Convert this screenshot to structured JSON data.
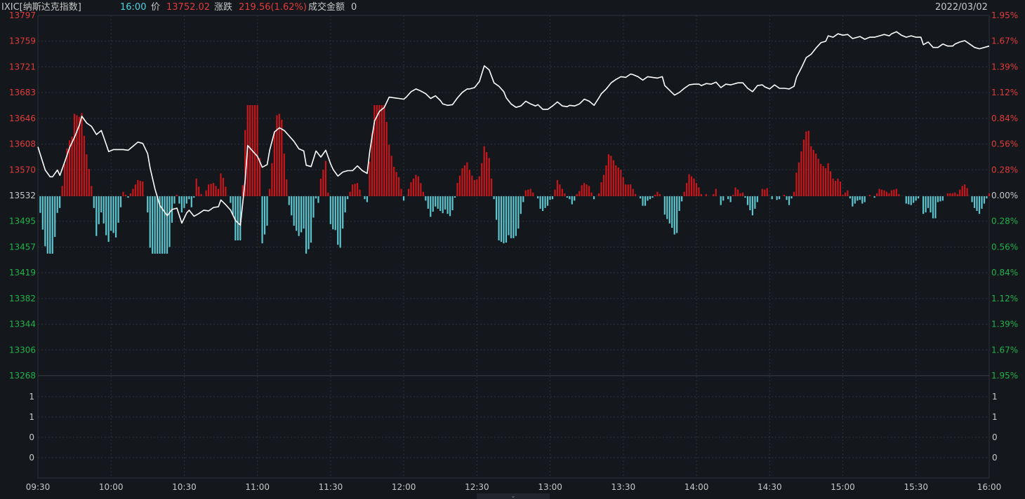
{
  "header": {
    "symbol": "IXIC[纳斯达克指数]",
    "time": "16:00",
    "price_label": "价",
    "price": "13752.02",
    "change_label": "涨跌",
    "change": "219.56(1.62%)",
    "amount_label": "成交金额",
    "amount": "0",
    "date": "2022/03/02"
  },
  "colors": {
    "background": "#14171c",
    "up": "#e03c3c",
    "down": "#22b14c",
    "bar_up": "#c8161a",
    "bar_down": "#5cc6d0",
    "price_line": "#ffffff",
    "time_cyan": "#4fd1e0",
    "text": "#c8c8c8",
    "grid": "#2e333a"
  },
  "chart_data": {
    "type": "line",
    "base_price": 13532,
    "price_axis_left": [
      "13797",
      "13759",
      "13721",
      "13683",
      "13646",
      "13608",
      "13570",
      "13532",
      "13495",
      "13457",
      "13419",
      "13382",
      "13344",
      "13306",
      "13268"
    ],
    "price_axis_right": [
      "1.95%",
      "1.67%",
      "1.39%",
      "1.12%",
      "0.84%",
      "0.56%",
      "0.28%",
      "0.00%",
      "0.28%",
      "0.56%",
      "0.84%",
      "1.12%",
      "1.39%",
      "1.67%",
      "1.95%"
    ],
    "ylim": [
      13268,
      13797
    ],
    "volume_axis": [
      "1",
      "1",
      "0",
      "0"
    ],
    "time_axis": [
      "09:30",
      "10:00",
      "10:30",
      "11:00",
      "11:30",
      "12:00",
      "12:30",
      "13:00",
      "13:30",
      "14:00",
      "14:30",
      "15:00",
      "15:30",
      "16:00"
    ],
    "total_minutes": 390,
    "price_series": [
      [
        0,
        13604
      ],
      [
        3,
        13570
      ],
      [
        5,
        13560
      ],
      [
        6,
        13560
      ],
      [
        8,
        13570
      ],
      [
        9,
        13562
      ],
      [
        11,
        13582
      ],
      [
        13,
        13603
      ],
      [
        15,
        13618
      ],
      [
        17,
        13636
      ],
      [
        18,
        13649
      ],
      [
        20,
        13639
      ],
      [
        22,
        13634
      ],
      [
        24,
        13622
      ],
      [
        26,
        13628
      ],
      [
        27,
        13618
      ],
      [
        29,
        13597
      ],
      [
        31,
        13600
      ],
      [
        33,
        13600
      ],
      [
        35,
        13600
      ],
      [
        37,
        13599
      ],
      [
        39,
        13605
      ],
      [
        41,
        13611
      ],
      [
        43,
        13609
      ],
      [
        45,
        13594
      ],
      [
        46,
        13573
      ],
      [
        48,
        13542
      ],
      [
        50,
        13518
      ],
      [
        52,
        13508
      ],
      [
        53,
        13503
      ],
      [
        55,
        13512
      ],
      [
        57,
        13514
      ],
      [
        59,
        13492
      ],
      [
        61,
        13507
      ],
      [
        62,
        13511
      ],
      [
        64,
        13502
      ],
      [
        66,
        13506
      ],
      [
        68,
        13511
      ],
      [
        70,
        13510
      ],
      [
        72,
        13515
      ],
      [
        74,
        13516
      ],
      [
        75,
        13526
      ],
      [
        77,
        13519
      ],
      [
        79,
        13511
      ],
      [
        81,
        13496
      ],
      [
        83,
        13489
      ],
      [
        85,
        13556
      ],
      [
        86,
        13606
      ],
      [
        88,
        13598
      ],
      [
        90,
        13590
      ],
      [
        92,
        13574
      ],
      [
        94,
        13578
      ],
      [
        95,
        13599
      ],
      [
        97,
        13626
      ],
      [
        99,
        13632
      ],
      [
        101,
        13628
      ],
      [
        103,
        13620
      ],
      [
        105,
        13612
      ],
      [
        107,
        13601
      ],
      [
        109,
        13598
      ],
      [
        110,
        13577
      ],
      [
        112,
        13575
      ],
      [
        114,
        13598
      ],
      [
        116,
        13589
      ],
      [
        118,
        13599
      ],
      [
        120,
        13579
      ],
      [
        121,
        13571
      ],
      [
        123,
        13561
      ],
      [
        125,
        13567
      ],
      [
        127,
        13569
      ],
      [
        129,
        13569
      ],
      [
        131,
        13576
      ],
      [
        133,
        13569
      ],
      [
        135,
        13565
      ],
      [
        136,
        13596
      ],
      [
        138,
        13642
      ],
      [
        140,
        13656
      ],
      [
        142,
        13662
      ],
      [
        144,
        13677
      ],
      [
        146,
        13676
      ],
      [
        148,
        13675
      ],
      [
        150,
        13674
      ],
      [
        151,
        13677
      ],
      [
        153,
        13685
      ],
      [
        155,
        13689
      ],
      [
        157,
        13686
      ],
      [
        159,
        13682
      ],
      [
        161,
        13675
      ],
      [
        163,
        13679
      ],
      [
        165,
        13672
      ],
      [
        166,
        13667
      ],
      [
        168,
        13665
      ],
      [
        170,
        13666
      ],
      [
        172,
        13676
      ],
      [
        174,
        13684
      ],
      [
        176,
        13689
      ],
      [
        177,
        13689
      ],
      [
        179,
        13691
      ],
      [
        181,
        13700
      ],
      [
        183,
        13723
      ],
      [
        185,
        13717
      ],
      [
        187,
        13698
      ],
      [
        189,
        13693
      ],
      [
        191,
        13685
      ],
      [
        192,
        13676
      ],
      [
        194,
        13667
      ],
      [
        196,
        13662
      ],
      [
        198,
        13664
      ],
      [
        200,
        13671
      ],
      [
        202,
        13667
      ],
      [
        204,
        13664
      ],
      [
        205,
        13666
      ],
      [
        207,
        13659
      ],
      [
        209,
        13659
      ],
      [
        211,
        13664
      ],
      [
        213,
        13670
      ],
      [
        215,
        13664
      ],
      [
        217,
        13663
      ],
      [
        218,
        13665
      ],
      [
        220,
        13664
      ],
      [
        222,
        13667
      ],
      [
        224,
        13674
      ],
      [
        226,
        13671
      ],
      [
        228,
        13665
      ],
      [
        230,
        13676
      ],
      [
        231,
        13682
      ],
      [
        233,
        13689
      ],
      [
        235,
        13698
      ],
      [
        237,
        13703
      ],
      [
        239,
        13707
      ],
      [
        241,
        13706
      ],
      [
        243,
        13711
      ],
      [
        244,
        13710
      ],
      [
        246,
        13707
      ],
      [
        248,
        13702
      ],
      [
        250,
        13707
      ],
      [
        252,
        13706
      ],
      [
        254,
        13705
      ],
      [
        256,
        13707
      ],
      [
        257,
        13694
      ],
      [
        259,
        13687
      ],
      [
        261,
        13680
      ],
      [
        263,
        13684
      ],
      [
        265,
        13690
      ],
      [
        267,
        13695
      ],
      [
        269,
        13696
      ],
      [
        271,
        13696
      ],
      [
        272,
        13694
      ],
      [
        274,
        13697
      ],
      [
        276,
        13696
      ],
      [
        278,
        13699
      ],
      [
        280,
        13691
      ],
      [
        282,
        13696
      ],
      [
        284,
        13695
      ],
      [
        285,
        13696
      ],
      [
        287,
        13698
      ],
      [
        289,
        13698
      ],
      [
        291,
        13690
      ],
      [
        293,
        13685
      ],
      [
        295,
        13694
      ],
      [
        297,
        13695
      ],
      [
        298,
        13692
      ],
      [
        300,
        13689
      ],
      [
        302,
        13695
      ],
      [
        304,
        13690
      ],
      [
        306,
        13690
      ],
      [
        308,
        13689
      ],
      [
        310,
        13693
      ],
      [
        311,
        13706
      ],
      [
        313,
        13720
      ],
      [
        315,
        13735
      ],
      [
        317,
        13740
      ],
      [
        319,
        13749
      ],
      [
        321,
        13757
      ],
      [
        323,
        13759
      ],
      [
        324,
        13767
      ],
      [
        326,
        13765
      ],
      [
        328,
        13770
      ],
      [
        330,
        13768
      ],
      [
        332,
        13769
      ],
      [
        334,
        13763
      ],
      [
        336,
        13765
      ],
      [
        337,
        13766
      ],
      [
        339,
        13762
      ],
      [
        341,
        13765
      ],
      [
        343,
        13765
      ],
      [
        345,
        13767
      ],
      [
        347,
        13769
      ],
      [
        349,
        13767
      ],
      [
        350,
        13770
      ],
      [
        352,
        13773
      ],
      [
        354,
        13768
      ],
      [
        356,
        13765
      ],
      [
        358,
        13767
      ],
      [
        360,
        13765
      ],
      [
        362,
        13765
      ],
      [
        363,
        13754
      ],
      [
        365,
        13758
      ],
      [
        367,
        13750
      ],
      [
        369,
        13750
      ],
      [
        371,
        13755
      ],
      [
        373,
        13752
      ],
      [
        375,
        13752
      ],
      [
        376,
        13755
      ],
      [
        378,
        13758
      ],
      [
        380,
        13760
      ],
      [
        382,
        13755
      ],
      [
        384,
        13750
      ],
      [
        386,
        13748
      ],
      [
        388,
        13750
      ],
      [
        390,
        13752
      ]
    ]
  }
}
